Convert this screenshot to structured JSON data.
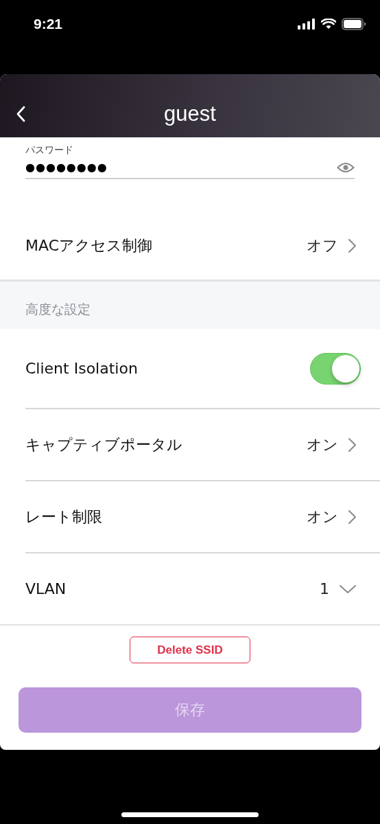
{
  "status_bar": {
    "time": "9:21"
  },
  "header": {
    "title": "guest"
  },
  "password": {
    "label": "パスワード",
    "value": "●●●●●●●●"
  },
  "settings": [
    {
      "kind": "link",
      "label": "MACアクセス制御",
      "value": "オフ"
    }
  ],
  "advanced": {
    "title": "高度な設定",
    "rows": [
      {
        "kind": "toggle",
        "label": "Client Isolation",
        "on": true
      },
      {
        "kind": "link",
        "label": "キャプティブポータル",
        "value": "オン"
      },
      {
        "kind": "link",
        "label": "レート制限",
        "value": "オン"
      },
      {
        "kind": "dropdown",
        "label": "VLAN",
        "value": "1"
      }
    ]
  },
  "delete_button": {
    "label": "Delete SSID"
  },
  "save_button": {
    "label": "保存",
    "disabled": true
  }
}
